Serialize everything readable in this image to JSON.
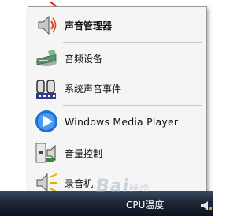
{
  "menu": {
    "items": [
      {
        "label": "声音管理器",
        "icon": "speaker-icon"
      },
      {
        "label": "音频设备",
        "icon": "audio-device-icon"
      },
      {
        "label": "系统声音事件",
        "icon": "sound-events-icon"
      },
      {
        "label": "Windows Media Player",
        "icon": "media-player-icon"
      },
      {
        "label": "音量控制",
        "icon": "volume-control-icon"
      },
      {
        "label": "录音机",
        "icon": "recorder-icon"
      }
    ]
  },
  "taskbar": {
    "tray_text": "CPU温度"
  },
  "watermark": {
    "text": "Bai",
    "suffix": "经验"
  },
  "colors": {
    "arrow": "#e8232a",
    "taskbar": "#1d2736",
    "wmp_blue": "#1e6fd0"
  }
}
